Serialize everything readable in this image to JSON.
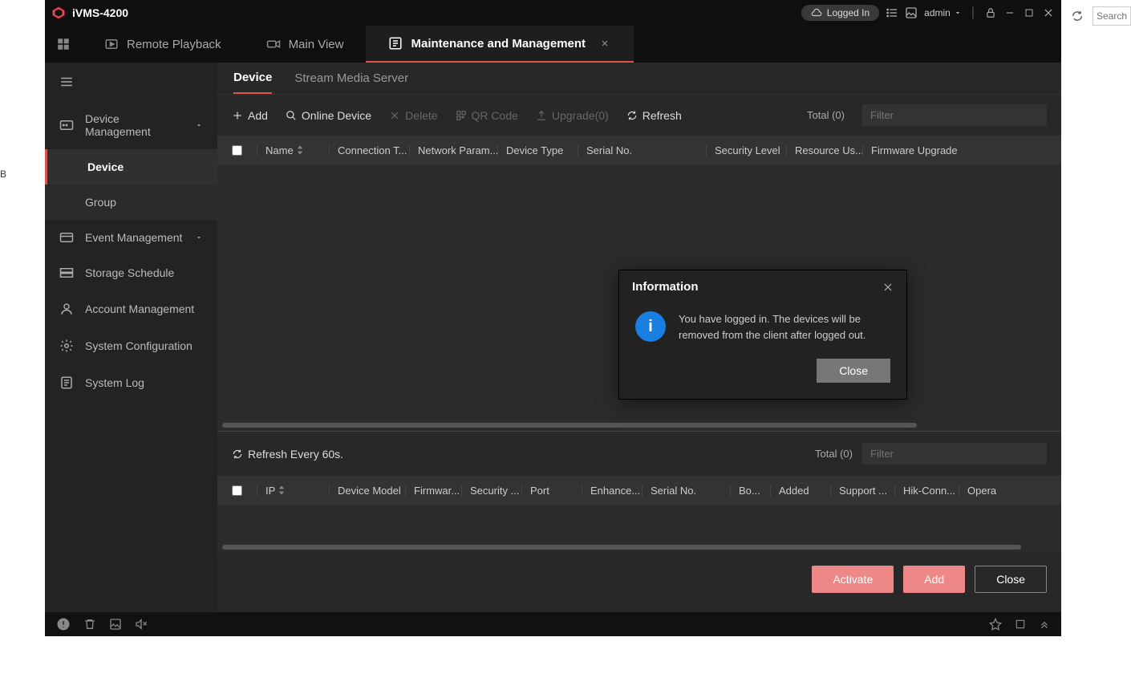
{
  "app": {
    "title": "iVMS-4200"
  },
  "titlebar": {
    "logged_in": "Logged In",
    "admin": "admin"
  },
  "tabs": {
    "remote_playback": "Remote Playback",
    "main_view": "Main View",
    "maintenance": "Maintenance and Management"
  },
  "sidebar": {
    "device_management": "Device Management",
    "device": "Device",
    "group": "Group",
    "event_management": "Event Management",
    "storage_schedule": "Storage Schedule",
    "account_management": "Account Management",
    "system_configuration": "System Configuration",
    "system_log": "System Log"
  },
  "subtabs": {
    "device": "Device",
    "stream_media": "Stream Media Server"
  },
  "toolbar": {
    "add": "Add",
    "online_device": "Online Device",
    "delete": "Delete",
    "qr_code": "QR Code",
    "upgrade": "Upgrade(0)",
    "refresh": "Refresh",
    "total": "Total (0)",
    "filter_placeholder": "Filter"
  },
  "table1": {
    "name": "Name",
    "connection": "Connection T...",
    "network": "Network Param...",
    "device_type": "Device Type",
    "serial": "Serial No.",
    "security": "Security Level",
    "resource": "Resource Us...",
    "firmware": "Firmware Upgrade"
  },
  "lower": {
    "refresh_every": "Refresh Every 60s.",
    "total": "Total (0)",
    "filter_placeholder": "Filter"
  },
  "table2": {
    "ip": "IP",
    "device_model": "Device Model",
    "firmware": "Firmwar...",
    "security": "Security ...",
    "port": "Port",
    "enhance": "Enhance...",
    "serial": "Serial No.",
    "bo": "Bo...",
    "added": "Added",
    "support": "Support ...",
    "hik": "Hik-Conn...",
    "opera": "Opera"
  },
  "buttons": {
    "activate": "Activate",
    "add": "Add",
    "close": "Close"
  },
  "modal": {
    "title": "Information",
    "message": "You have logged in. The devices will be removed from the client after logged out.",
    "close": "Close"
  },
  "browser": {
    "search_placeholder": "Search"
  },
  "left_frag": "B"
}
